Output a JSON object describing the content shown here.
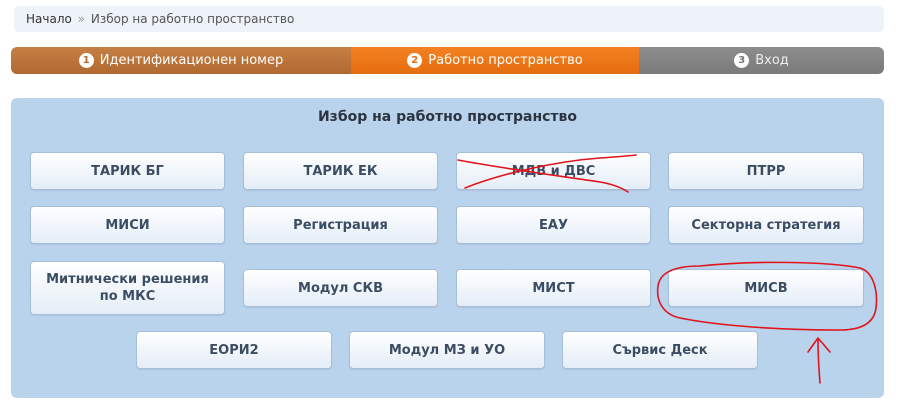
{
  "breadcrumb": {
    "home": "Начало",
    "separator": "»",
    "current": "Избор на работно пространство"
  },
  "steps": [
    {
      "number": "1",
      "label": "Идентификационен номер",
      "state": "completed"
    },
    {
      "number": "2",
      "label": "Работно пространство",
      "state": "active"
    },
    {
      "number": "3",
      "label": "Вход",
      "state": "pending"
    }
  ],
  "panel": {
    "title": "Избор на работно пространство",
    "buttons": {
      "tarik_bg": "ТАРИК БГ",
      "tarik_ek": "ТАРИК ЕК",
      "mdv_dvs": "МДВ и ДВС",
      "ptrr": "ПТРР",
      "misi": "МИСИ",
      "registration": "Регистрация",
      "eau": "ЕАУ",
      "sector_strategy": "Секторна стратегия",
      "customs_decisions": "Митнически решения по МКС",
      "module_skv": "Модул СКВ",
      "mist": "МИСТ",
      "misv": "МИСВ",
      "eori2": "ЕОРИ2",
      "module_mz_uo": "Модул МЗ и УО",
      "service_desk": "Сървис Деск"
    }
  },
  "colors": {
    "step_completed": "#b06a30",
    "step_active": "#f07a1a",
    "step_pending": "#808080",
    "panel_bg": "#bad3ec",
    "annotation": "#e0141c"
  }
}
